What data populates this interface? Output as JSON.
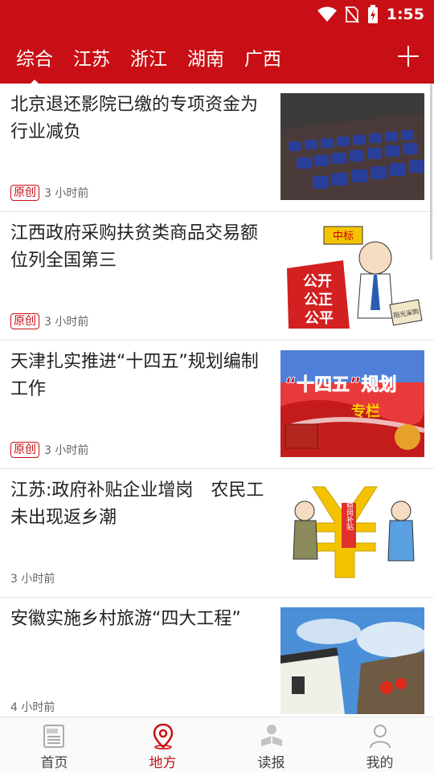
{
  "status": {
    "time": "1:55"
  },
  "tabs": [
    {
      "label": "综合",
      "active": true
    },
    {
      "label": "江苏"
    },
    {
      "label": "浙江"
    },
    {
      "label": "湖南"
    },
    {
      "label": "广西"
    }
  ],
  "articles": [
    {
      "title": "北京退还影院已缴的专项资金为行业减负",
      "badge": "原创",
      "time": "3 小时前"
    },
    {
      "title": "江西政府采购扶贫类商品交易额位列全国第三",
      "badge": "原创",
      "time": "3 小时前",
      "image_text": {
        "sign": "中标",
        "board": [
          "公开",
          "公正",
          "公平"
        ],
        "paper": "阳光采购"
      }
    },
    {
      "title": "天津扎实推进“十四五”规划编制工作",
      "badge": "原创",
      "time": "3 小时前",
      "image_text": {
        "headline": "“十四五”规划",
        "sub": "专栏"
      }
    },
    {
      "title": "江苏:政府补贴企业增岗　农民工未出现返乡潮",
      "time": "3 小时前",
      "image_text": {
        "symbol_label": "稳岗补贴"
      }
    },
    {
      "title": "安徽实施乡村旅游“四大工程”",
      "time": "4 小时前"
    }
  ],
  "bottom_nav": [
    {
      "label": "首页",
      "icon": "newspaper-icon"
    },
    {
      "label": "地方",
      "icon": "location-pin-icon",
      "active": true
    },
    {
      "label": "读报",
      "icon": "reader-icon"
    },
    {
      "label": "我的",
      "icon": "person-icon"
    }
  ],
  "colors": {
    "brand": "#c80f15"
  }
}
